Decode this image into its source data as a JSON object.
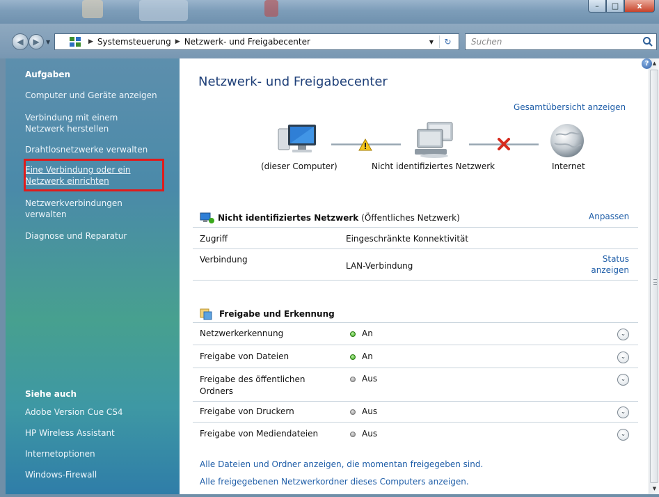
{
  "window": {
    "controls": {
      "minimize": "–",
      "maximize": "□",
      "close": "x"
    }
  },
  "addressbar": {
    "breadcrumb": [
      "Systemsteuerung",
      "Netzwerk- und Freigabecenter"
    ],
    "search_placeholder": "Suchen"
  },
  "sidebar": {
    "tasks_heading": "Aufgaben",
    "tasks": [
      "Computer und Geräte anzeigen",
      "Verbindung mit einem Netzwerk herstellen",
      "Drahtlosnetzwerke verwalten",
      "Eine Verbindung oder ein Netzwerk einrichten",
      "Netzwerkverbindungen verwalten",
      "Diagnose und Reparatur"
    ],
    "see_also_heading": "Siehe auch",
    "see_also": [
      "Adobe Version Cue CS4",
      "HP Wireless Assistant",
      "Internetoptionen",
      "Windows-Firewall"
    ]
  },
  "main": {
    "title": "Netzwerk- und Freigabecenter",
    "overview_link": "Gesamtübersicht anzeigen",
    "map": {
      "computer": "(dieser Computer)",
      "network": "Nicht identifiziertes Netzwerk",
      "internet": "Internet"
    },
    "network": {
      "name": "Nicht identifiziertes Netzwerk",
      "type": "(Öffentliches Netzwerk)",
      "customize": "Anpassen",
      "access_label": "Zugriff",
      "access_value": "Eingeschränkte Konnektivität",
      "connection_label": "Verbindung",
      "connection_value": "LAN-Verbindung",
      "status_link_1": "Status",
      "status_link_2": "anzeigen"
    },
    "sharing": {
      "heading": "Freigabe und Erkennung",
      "rows": [
        {
          "label": "Netzwerkerkennung",
          "state": "An"
        },
        {
          "label": "Freigabe von Dateien",
          "state": "An"
        },
        {
          "label": "Freigabe des öffentlichen Ordners",
          "state": "Aus"
        },
        {
          "label": "Freigabe von Druckern",
          "state": "Aus"
        },
        {
          "label": "Freigabe von Mediendateien",
          "state": "Aus"
        }
      ]
    },
    "links": [
      "Alle Dateien und Ordner anzeigen, die momentan freigegeben sind.",
      "Alle freigegebenen Netzwerkordner dieses Computers anzeigen."
    ]
  },
  "colors": {
    "link": "#1f5ea8",
    "title": "#1e3f78",
    "highlight_box": "#e01b1b",
    "status_on": "#3aa81b",
    "status_off": "#8e8e8e"
  }
}
